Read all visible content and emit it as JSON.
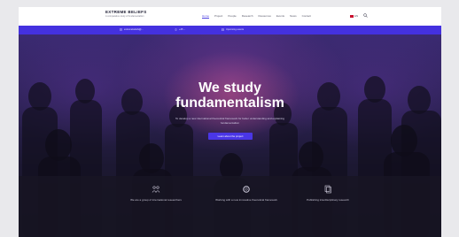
{
  "header": {
    "logo_title": "EXTREME BELIEFS",
    "logo_subtitle": "A comparative study of fundamentalism",
    "nav": [
      "Home",
      "Project",
      "People",
      "Research",
      "Resources",
      "Events",
      "News",
      "Contact"
    ],
    "active_nav": "Home",
    "language": "EN"
  },
  "infobar": {
    "items": [
      {
        "icon": "email-icon",
        "text": "extremebeliefs@..."
      },
      {
        "icon": "phone-icon",
        "text": "+45 ..."
      },
      {
        "icon": "calendar-icon",
        "text": "Upcoming events"
      }
    ]
  },
  "hero": {
    "title_line1": "We study",
    "title_line2": "fundamentalism",
    "text": "To develop a new international theoretical framework for better understanding and explaining fundamentalism",
    "button": "Learn about the project"
  },
  "features": [
    {
      "icon": "people-icon",
      "text": "We are a group of international researchers"
    },
    {
      "icon": "circle-framework-icon",
      "text": "Working with a new innovative theoretical framework"
    },
    {
      "icon": "document-icon",
      "text": "Publishing interdisciplinary research"
    }
  ],
  "colors": {
    "accent": "#4431df",
    "hero_bg": "#171523",
    "header_bg": "#ffffff"
  }
}
